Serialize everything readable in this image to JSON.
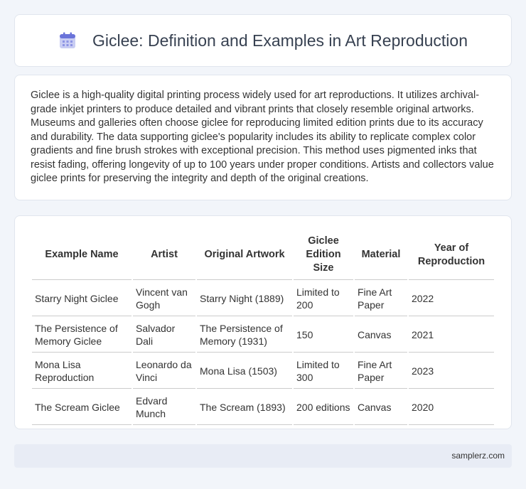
{
  "header": {
    "title": "Giclee: Definition and Examples in Art Reproduction",
    "icon": "calendar-icon"
  },
  "description": "Giclee is a high-quality digital printing process widely used for art reproductions. It utilizes archival-grade inkjet printers to produce detailed and vibrant prints that closely resemble original artworks. Museums and galleries often choose giclee for reproducing limited edition prints due to its accuracy and durability. The data supporting giclee's popularity includes its ability to replicate complex color gradients and fine brush strokes with exceptional precision. This method uses pigmented inks that resist fading, offering longevity of up to 100 years under proper conditions. Artists and collectors value giclee prints for preserving the integrity and depth of the original creations.",
  "table": {
    "headers": [
      "Example Name",
      "Artist",
      "Original Artwork",
      "Giclee Edition Size",
      "Material",
      "Year of Reproduction"
    ],
    "rows": [
      [
        "Starry Night Giclee",
        "Vincent van Gogh",
        "Starry Night (1889)",
        "Limited to 200",
        "Fine Art Paper",
        "2022"
      ],
      [
        "The Persistence of Memory Giclee",
        "Salvador Dali",
        "The Persistence of Memory (1931)",
        "150",
        "Canvas",
        "2021"
      ],
      [
        "Mona Lisa Reproduction",
        "Leonardo da Vinci",
        "Mona Lisa (1503)",
        "Limited to 300",
        "Fine Art Paper",
        "2023"
      ],
      [
        "The Scream Giclee",
        "Edvard Munch",
        "The Scream (1893)",
        "200 editions",
        "Canvas",
        "2020"
      ]
    ]
  },
  "footer": {
    "site": "samplerz.com"
  }
}
